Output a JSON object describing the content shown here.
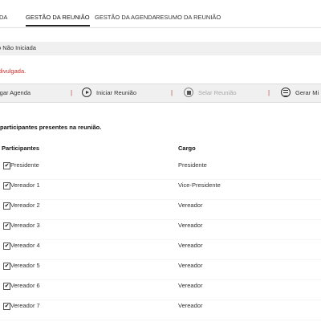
{
  "tabs": [
    {
      "label": "DA"
    },
    {
      "label": "GESTÃO DA REUNIÃO"
    },
    {
      "label": "GESTÃO DA AGENDA"
    },
    {
      "label": "RESUMO DA REUNIÃO"
    }
  ],
  "status": {
    "text": "o Não Iniciada"
  },
  "warning": {
    "text": "divulgada."
  },
  "toolbar": {
    "items": [
      {
        "label": "lgar Agenda",
        "icon": "none"
      },
      {
        "label": "Iniciar Reunião",
        "icon": "play-icon"
      },
      {
        "label": "Selar Reunião",
        "icon": "stop-icon",
        "disabled": true
      },
      {
        "label": "Gerar Mi",
        "icon": "document-icon"
      }
    ],
    "separator": "|"
  },
  "instruction": "participantes presentes na reunião.",
  "table": {
    "headers": {
      "participants": "Participantes",
      "role": "Cargo"
    },
    "rows": [
      {
        "name": "Presidente",
        "role": "Presidente",
        "checked": true
      },
      {
        "name": "Vereador 1",
        "role": "Vice-Presidente",
        "checked": true
      },
      {
        "name": "Vereador 2",
        "role": "Vereador",
        "checked": true
      },
      {
        "name": "Vereador 3",
        "role": "Vereador",
        "checked": true
      },
      {
        "name": "Vereador 4",
        "role": "Vereador",
        "checked": true
      },
      {
        "name": "Vereador 5",
        "role": "Vereador",
        "checked": true
      },
      {
        "name": "Vereador 6",
        "role": "Vereador",
        "checked": true
      },
      {
        "name": "Vereador 7",
        "role": "Vereador",
        "checked": true
      }
    ]
  }
}
